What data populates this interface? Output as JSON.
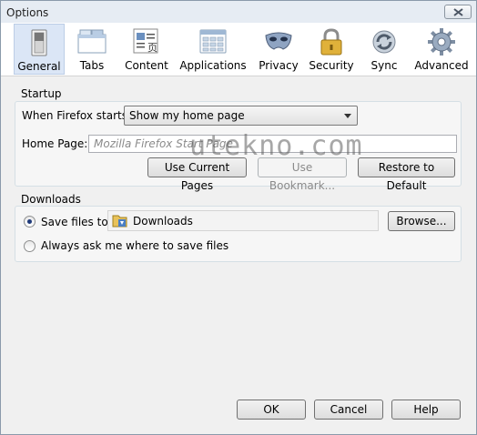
{
  "window": {
    "title": "Options"
  },
  "toolbar": {
    "panes": [
      {
        "label": "General",
        "icon": "switch-icon",
        "selected": true
      },
      {
        "label": "Tabs",
        "icon": "tabs-icon",
        "selected": false
      },
      {
        "label": "Content",
        "icon": "content-icon",
        "selected": false
      },
      {
        "label": "Applications",
        "icon": "applications-icon",
        "selected": false
      },
      {
        "label": "Privacy",
        "icon": "mask-icon",
        "selected": false
      },
      {
        "label": "Security",
        "icon": "padlock-icon",
        "selected": false
      },
      {
        "label": "Sync",
        "icon": "sync-icon",
        "selected": false
      },
      {
        "label": "Advanced",
        "icon": "gear-icon",
        "selected": false
      }
    ]
  },
  "startup": {
    "group_label": "Startup",
    "when_label": "When Firefox starts:",
    "when_value": "Show my home page",
    "home_label": "Home Page:",
    "home_placeholder": "Mozilla Firefox Start Page",
    "use_current_label": "Use Current Pages",
    "use_bookmark_label": "Use Bookmark...",
    "restore_label": "Restore to Default"
  },
  "downloads": {
    "group_label": "Downloads",
    "save_label": "Save files to",
    "folder": "Downloads",
    "browse_label": "Browse...",
    "ask_label": "Always ask me where to save files",
    "save_selected": true
  },
  "footer": {
    "ok_label": "OK",
    "cancel_label": "Cancel",
    "help_label": "Help"
  },
  "watermark": "utekno.com",
  "colors": {
    "selected_pane": "#dbe6f6",
    "dialog_bg": "#f0f0f0",
    "group_border": "#d5dfe5"
  }
}
